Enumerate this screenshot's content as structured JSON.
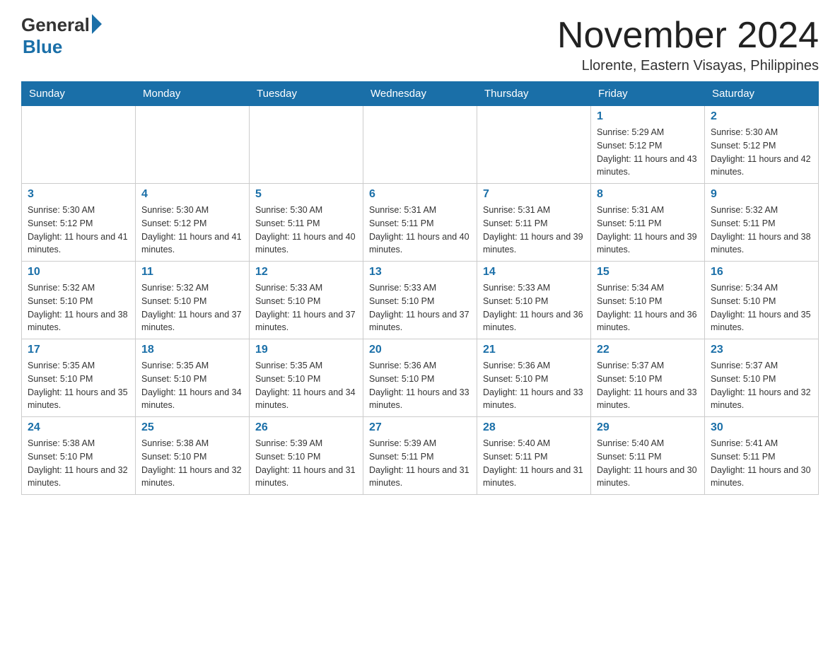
{
  "header": {
    "logo_general": "General",
    "logo_blue": "Blue",
    "main_title": "November 2024",
    "subtitle": "Llorente, Eastern Visayas, Philippines"
  },
  "calendar": {
    "days_of_week": [
      "Sunday",
      "Monday",
      "Tuesday",
      "Wednesday",
      "Thursday",
      "Friday",
      "Saturday"
    ],
    "weeks": [
      [
        {
          "day": "",
          "info": ""
        },
        {
          "day": "",
          "info": ""
        },
        {
          "day": "",
          "info": ""
        },
        {
          "day": "",
          "info": ""
        },
        {
          "day": "",
          "info": ""
        },
        {
          "day": "1",
          "info": "Sunrise: 5:29 AM\nSunset: 5:12 PM\nDaylight: 11 hours and 43 minutes."
        },
        {
          "day": "2",
          "info": "Sunrise: 5:30 AM\nSunset: 5:12 PM\nDaylight: 11 hours and 42 minutes."
        }
      ],
      [
        {
          "day": "3",
          "info": "Sunrise: 5:30 AM\nSunset: 5:12 PM\nDaylight: 11 hours and 41 minutes."
        },
        {
          "day": "4",
          "info": "Sunrise: 5:30 AM\nSunset: 5:12 PM\nDaylight: 11 hours and 41 minutes."
        },
        {
          "day": "5",
          "info": "Sunrise: 5:30 AM\nSunset: 5:11 PM\nDaylight: 11 hours and 40 minutes."
        },
        {
          "day": "6",
          "info": "Sunrise: 5:31 AM\nSunset: 5:11 PM\nDaylight: 11 hours and 40 minutes."
        },
        {
          "day": "7",
          "info": "Sunrise: 5:31 AM\nSunset: 5:11 PM\nDaylight: 11 hours and 39 minutes."
        },
        {
          "day": "8",
          "info": "Sunrise: 5:31 AM\nSunset: 5:11 PM\nDaylight: 11 hours and 39 minutes."
        },
        {
          "day": "9",
          "info": "Sunrise: 5:32 AM\nSunset: 5:11 PM\nDaylight: 11 hours and 38 minutes."
        }
      ],
      [
        {
          "day": "10",
          "info": "Sunrise: 5:32 AM\nSunset: 5:10 PM\nDaylight: 11 hours and 38 minutes."
        },
        {
          "day": "11",
          "info": "Sunrise: 5:32 AM\nSunset: 5:10 PM\nDaylight: 11 hours and 37 minutes."
        },
        {
          "day": "12",
          "info": "Sunrise: 5:33 AM\nSunset: 5:10 PM\nDaylight: 11 hours and 37 minutes."
        },
        {
          "day": "13",
          "info": "Sunrise: 5:33 AM\nSunset: 5:10 PM\nDaylight: 11 hours and 37 minutes."
        },
        {
          "day": "14",
          "info": "Sunrise: 5:33 AM\nSunset: 5:10 PM\nDaylight: 11 hours and 36 minutes."
        },
        {
          "day": "15",
          "info": "Sunrise: 5:34 AM\nSunset: 5:10 PM\nDaylight: 11 hours and 36 minutes."
        },
        {
          "day": "16",
          "info": "Sunrise: 5:34 AM\nSunset: 5:10 PM\nDaylight: 11 hours and 35 minutes."
        }
      ],
      [
        {
          "day": "17",
          "info": "Sunrise: 5:35 AM\nSunset: 5:10 PM\nDaylight: 11 hours and 35 minutes."
        },
        {
          "day": "18",
          "info": "Sunrise: 5:35 AM\nSunset: 5:10 PM\nDaylight: 11 hours and 34 minutes."
        },
        {
          "day": "19",
          "info": "Sunrise: 5:35 AM\nSunset: 5:10 PM\nDaylight: 11 hours and 34 minutes."
        },
        {
          "day": "20",
          "info": "Sunrise: 5:36 AM\nSunset: 5:10 PM\nDaylight: 11 hours and 33 minutes."
        },
        {
          "day": "21",
          "info": "Sunrise: 5:36 AM\nSunset: 5:10 PM\nDaylight: 11 hours and 33 minutes."
        },
        {
          "day": "22",
          "info": "Sunrise: 5:37 AM\nSunset: 5:10 PM\nDaylight: 11 hours and 33 minutes."
        },
        {
          "day": "23",
          "info": "Sunrise: 5:37 AM\nSunset: 5:10 PM\nDaylight: 11 hours and 32 minutes."
        }
      ],
      [
        {
          "day": "24",
          "info": "Sunrise: 5:38 AM\nSunset: 5:10 PM\nDaylight: 11 hours and 32 minutes."
        },
        {
          "day": "25",
          "info": "Sunrise: 5:38 AM\nSunset: 5:10 PM\nDaylight: 11 hours and 32 minutes."
        },
        {
          "day": "26",
          "info": "Sunrise: 5:39 AM\nSunset: 5:10 PM\nDaylight: 11 hours and 31 minutes."
        },
        {
          "day": "27",
          "info": "Sunrise: 5:39 AM\nSunset: 5:11 PM\nDaylight: 11 hours and 31 minutes."
        },
        {
          "day": "28",
          "info": "Sunrise: 5:40 AM\nSunset: 5:11 PM\nDaylight: 11 hours and 31 minutes."
        },
        {
          "day": "29",
          "info": "Sunrise: 5:40 AM\nSunset: 5:11 PM\nDaylight: 11 hours and 30 minutes."
        },
        {
          "day": "30",
          "info": "Sunrise: 5:41 AM\nSunset: 5:11 PM\nDaylight: 11 hours and 30 minutes."
        }
      ]
    ]
  }
}
